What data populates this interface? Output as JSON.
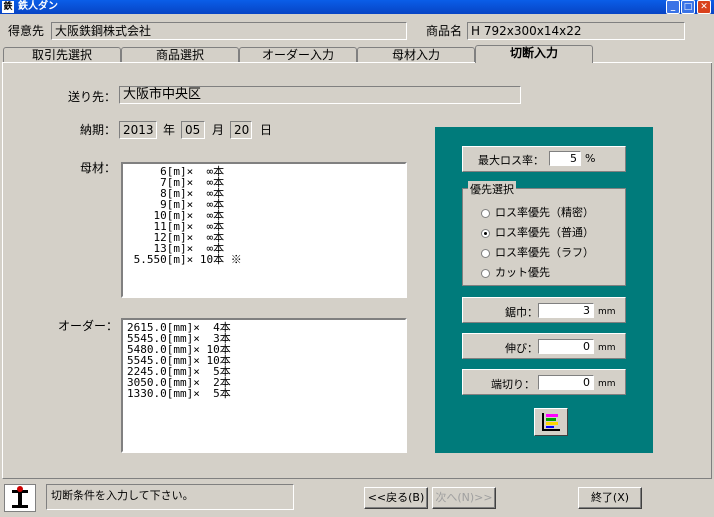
{
  "window": {
    "title": "鉄人ダン"
  },
  "header": {
    "customer_label": "得意先",
    "customer_value": "大阪鉄鋼株式会社",
    "product_label": "商品名",
    "product_value": "H 792x300x14x22"
  },
  "tabs": [
    {
      "label": "取引先選択"
    },
    {
      "label": "商品選択"
    },
    {
      "label": "オーダー入力"
    },
    {
      "label": "母材入力"
    },
    {
      "label": "切断入力"
    }
  ],
  "form": {
    "destination_label": "送り先：",
    "destination_value": "大阪市中央区",
    "delivery_label": "納期：",
    "year": "2013",
    "year_unit": "年",
    "month": "05",
    "month_unit": "月",
    "day": "20",
    "day_unit": "日",
    "material_label": "母材：",
    "material_text": "     6[m]×  ∞本\n     7[m]×  ∞本\n     8[m]×  ∞本\n     9[m]×  ∞本\n    10[m]×  ∞本\n    11[m]×  ∞本\n    12[m]×  ∞本\n    13[m]×  ∞本\n 5.550[m]× 10本 ※",
    "order_label": "オーダー：",
    "order_text": "2615.0[mm]×  4本\n5545.0[mm]×  3本\n5480.0[mm]× 10本\n5545.0[mm]× 10本\n2245.0[mm]×  5本\n3050.0[mm]×  2本\n1330.0[mm]×  5本"
  },
  "settings": {
    "max_loss_label": "最大ロス率：",
    "max_loss_value": "5",
    "max_loss_unit": "%",
    "priority_title": "優先選択",
    "options": [
      {
        "label": "ロス率優先（精密）",
        "checked": false
      },
      {
        "label": "ロス率優先（普通）",
        "checked": true
      },
      {
        "label": "ロス率優先（ラフ）",
        "checked": false
      },
      {
        "label": "カット優先",
        "checked": false
      }
    ],
    "kerf_label": "鋸巾：",
    "kerf_value": "3",
    "stretch_label": "伸び：",
    "stretch_value": "0",
    "end_cut_label": "端切り：",
    "end_cut_value": "0",
    "mm_unit": "mm"
  },
  "footer": {
    "status_text": "切断条件を入力して下さい。",
    "back_label": "<<戻る(B)",
    "next_label": "次へ(N)>>",
    "exit_label": "終了(X)"
  }
}
